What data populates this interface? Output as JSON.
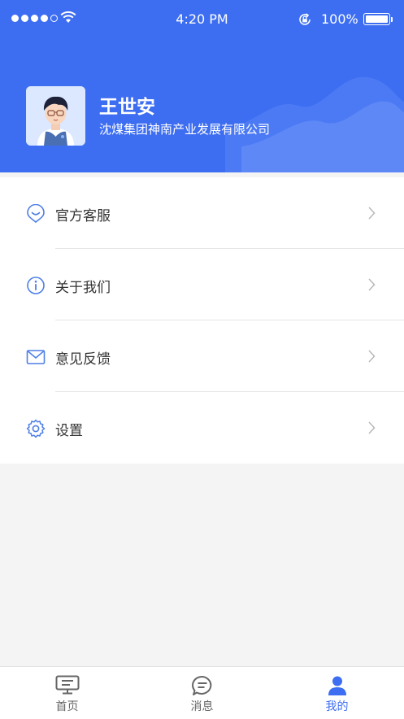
{
  "status_bar": {
    "time": "4:20 PM",
    "battery": "100%",
    "signal_bars_filled": 4,
    "signal_bars_total": 5
  },
  "profile": {
    "name": "王世安",
    "organization": "沈煤集团神南产业发展有限公司"
  },
  "menu": [
    {
      "label": "官方客服",
      "icon": "customer-service-icon"
    },
    {
      "label": "关于我们",
      "icon": "info-icon"
    },
    {
      "label": "意见反馈",
      "icon": "mail-icon"
    },
    {
      "label": "设置",
      "icon": "gear-icon"
    }
  ],
  "tabs": [
    {
      "label": "首页",
      "icon": "home-monitor-icon",
      "active": false
    },
    {
      "label": "消息",
      "icon": "message-icon",
      "active": false
    },
    {
      "label": "我的",
      "icon": "person-icon",
      "active": true
    }
  ],
  "colors": {
    "accent": "#3d6ef2",
    "header_bg": "#3d6ef2",
    "icon_blue": "#4f7fe6",
    "page_bg": "#f4f4f4"
  }
}
